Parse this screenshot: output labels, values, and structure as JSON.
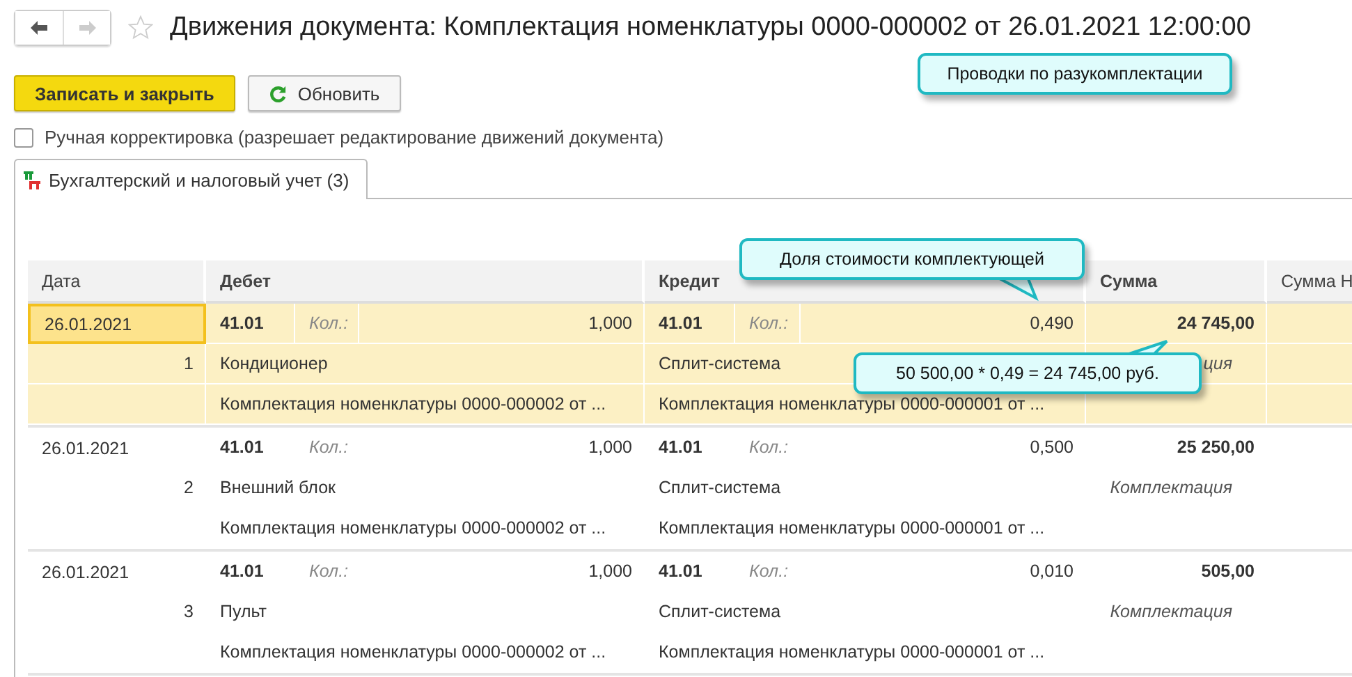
{
  "title": "Движения документа: Комплектация номенклатуры 0000-000002 от 26.01.2021 12:00:00",
  "favorite": false,
  "buttons": [
    {
      "label": "Записать и закрыть",
      "kind": "primary"
    },
    {
      "label": "Обновить",
      "kind": "refresh"
    }
  ],
  "manual_edit": {
    "label": "Ручная корректировка (разрешает редактирование движений документа)",
    "checked": false
  },
  "tabs": [
    {
      "label": "Бухгалтерский и налоговый учет (3)",
      "selected": true
    }
  ],
  "columns": [
    "Дата",
    "Дебет",
    "Кредит",
    "Сумма",
    "Сумма Н"
  ],
  "rows": [
    {
      "selected": true,
      "date": "26.01.2021",
      "number": "1",
      "debit_account": "41.01",
      "debit_qty_label": "Кол.:",
      "debit_qty": "1,000",
      "debit_item": "Кондиционер",
      "debit_doc": "Комплектация номенклатуры 0000-000002 от ...",
      "credit_account": "41.01",
      "credit_qty_label": "Кол.:",
      "credit_qty": "0,490",
      "credit_item": "Сплит-система",
      "credit_doc": "Комплектация номенклатуры 0000-000001 от ...",
      "sum": "24 745,00",
      "note": "ция"
    },
    {
      "selected": false,
      "date": "26.01.2021",
      "number": "2",
      "debit_account": "41.01",
      "debit_qty_label": "Кол.:",
      "debit_qty": "1,000",
      "debit_item": "Внешний блок",
      "debit_doc": "Комплектация номенклатуры 0000-000002 от ...",
      "credit_account": "41.01",
      "credit_qty_label": "Кол.:",
      "credit_qty": "0,500",
      "credit_item": "Сплит-система",
      "credit_doc": "Комплектация номенклатуры 0000-000001 от ...",
      "sum": "25 250,00",
      "note": "Комплектация"
    },
    {
      "selected": false,
      "date": "26.01.2021",
      "number": "3",
      "debit_account": "41.01",
      "debit_qty_label": "Кол.:",
      "debit_qty": "1,000",
      "debit_item": "Пульт",
      "debit_doc": "Комплектация номенклатуры 0000-000002 от ...",
      "credit_account": "41.01",
      "credit_qty_label": "Кол.:",
      "credit_qty": "0,010",
      "credit_item": "Сплит-система",
      "credit_doc": "Комплектация номенклатуры 0000-000001 от ...",
      "sum": "505,00",
      "note": "Комплектация"
    }
  ],
  "callouts": [
    {
      "text": "Проводки по разукомплектации",
      "kind": "plain"
    },
    {
      "text": "Доля стоимости комплектующей",
      "kind": "tail-down"
    },
    {
      "text": "50 500,00 * 0,49 = 24 745,00 руб.",
      "kind": "tail-up"
    }
  ]
}
